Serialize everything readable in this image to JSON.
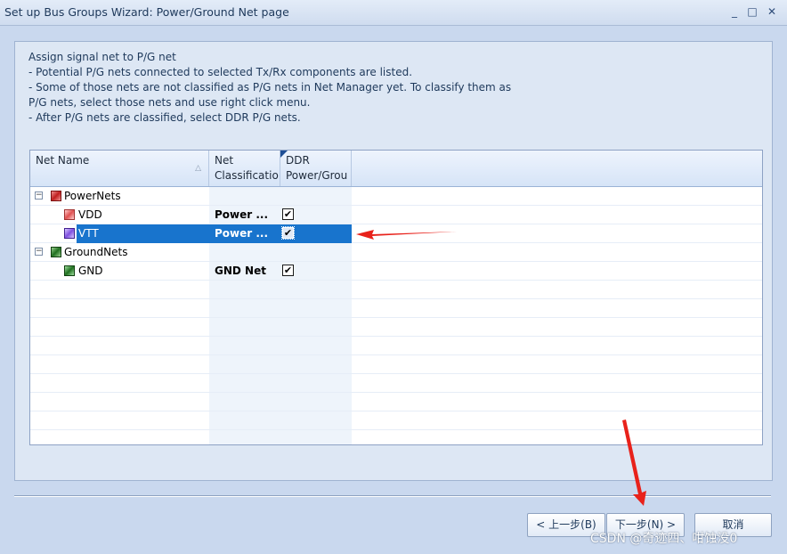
{
  "window": {
    "title": "Set up Bus Groups Wizard: Power/Ground Net page",
    "min_glyph": "_",
    "max_glyph": "□",
    "close_glyph": "✕"
  },
  "instructions": [
    "Assign signal net to P/G net",
    "- Potential P/G nets connected to selected Tx/Rx components are listed.",
    "- Some of those nets are not classified as P/G nets in Net Manager yet. To classify them as",
    "P/G nets, select those nets and use right click menu.",
    "- After P/G nets are classified, select DDR P/G nets."
  ],
  "grid": {
    "headers": {
      "net_name": "Net Name",
      "classification_line1": "Net",
      "classification_line2": "Classificatio",
      "ddr_line1": "DDR",
      "ddr_line2": "Power/Grou"
    },
    "sort_glyph": "△",
    "expander_glyph": "−",
    "check_glyph": "✔",
    "rows": [
      {
        "name": "PowerNets",
        "classification": "",
        "ddr": "",
        "icon": "powernets-icon"
      },
      {
        "name": "VDD",
        "classification": "Power ...",
        "ddr": "checked",
        "icon": "vdd-net-icon"
      },
      {
        "name": "VTT",
        "classification": "Power ...",
        "ddr": "checked",
        "icon": "vtt-net-icon",
        "selected": true
      },
      {
        "name": "GroundNets",
        "classification": "",
        "ddr": "",
        "icon": "groundnets-icon"
      },
      {
        "name": "GND",
        "classification": "GND Net",
        "ddr": "checked",
        "icon": "gnd-net-icon"
      }
    ]
  },
  "buttons": {
    "prev": "< 上一步(B)",
    "next": "下一步(N) >",
    "cancel": "取消"
  },
  "watermark": "CSDN @奇迹四、咁蚀没0",
  "colors": {
    "selection": "#1874cd",
    "annotation_arrow": "#e8221b"
  }
}
